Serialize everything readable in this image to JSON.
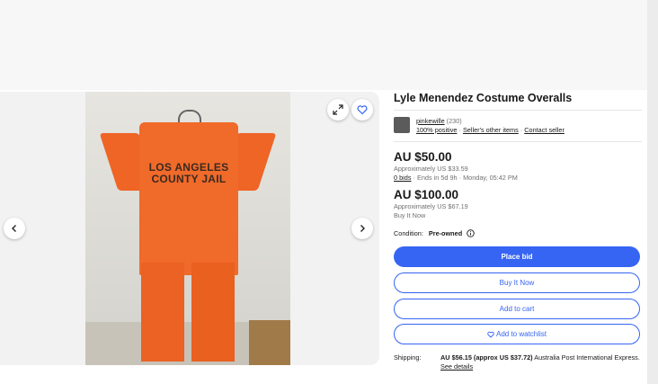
{
  "listing": {
    "title": "Lyle Menendez Costume Overalls",
    "photo_print": "LOS ANGELES COUNTY JAIL"
  },
  "seller": {
    "name": "pinkewille",
    "feedback_count": "(230)",
    "positive": "100% positive",
    "other_items": "Seller's other items",
    "contact": "Contact seller"
  },
  "auction": {
    "price": "AU $50.00",
    "approx": "Approximately US $33.59",
    "bids": "0 bids",
    "ends": "Ends in 5d 9h · Monday, 05:42 PM"
  },
  "buy_now": {
    "price": "AU $100.00",
    "approx": "Approximately US $67.19",
    "label": "Buy It Now"
  },
  "condition": {
    "label": "Condition:",
    "value": "Pre-owned"
  },
  "buttons": {
    "place_bid": "Place bid",
    "buy_it_now": "Buy It Now",
    "add_to_cart": "Add to cart",
    "add_to_watchlist": "Add to watchlist"
  },
  "shipping": {
    "label": "Shipping:",
    "cost": "AU $56.15 (approx US $37.72)",
    "service": "Australia Post International Express.",
    "details": "See details"
  },
  "icons": {
    "expand": "expand-icon",
    "watch": "heart-icon",
    "prev": "chevron-left-icon",
    "next": "chevron-right-icon",
    "info": "info-icon"
  },
  "colors": {
    "accent": "#3665f3",
    "jumpsuit": "#f06a2a"
  }
}
